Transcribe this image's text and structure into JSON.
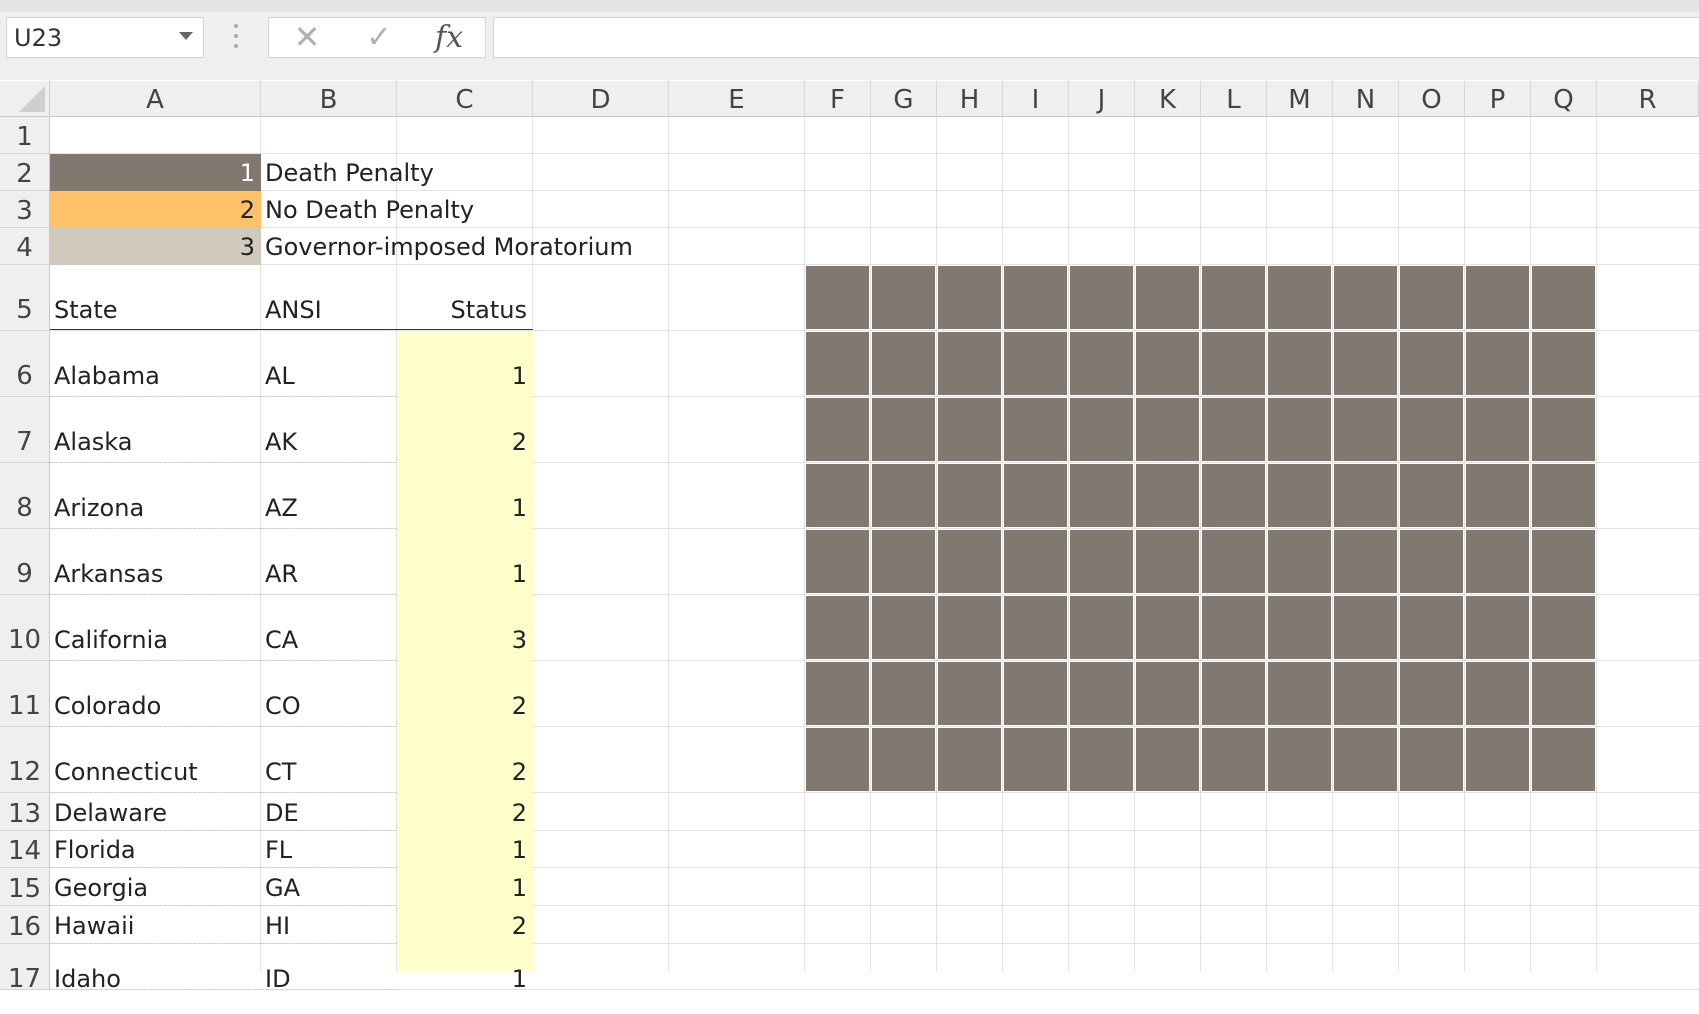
{
  "formula_bar": {
    "name_box": "U23",
    "cancel_glyph": "✕",
    "enter_glyph": "✓",
    "fx_label": "fx",
    "formula": ""
  },
  "columns": [
    "A",
    "B",
    "C",
    "D",
    "E",
    "F",
    "G",
    "H",
    "I",
    "J",
    "K",
    "L",
    "M",
    "N",
    "O",
    "P",
    "Q",
    "R"
  ],
  "rows": [
    "1",
    "2",
    "3",
    "4",
    "5",
    "6",
    "7",
    "8",
    "9",
    "10",
    "11",
    "12",
    "13",
    "14",
    "15",
    "16",
    "17"
  ],
  "legend": [
    {
      "code": "1",
      "label": "Death Penalty",
      "color": "#817870",
      "text_color": "#ffffff"
    },
    {
      "code": "2",
      "label": "No Death Penalty",
      "color": "#ffc26b",
      "text_color": "#222222"
    },
    {
      "code": "3",
      "label": "Governor-imposed Moratorium",
      "color": "#d2c9bd",
      "text_color": "#222222"
    }
  ],
  "table_headers": {
    "state": "State",
    "ansi": "ANSI",
    "status": "Status"
  },
  "states": [
    {
      "state": "Alabama",
      "ansi": "AL",
      "status": "1"
    },
    {
      "state": "Alaska",
      "ansi": "AK",
      "status": "2"
    },
    {
      "state": "Arizona",
      "ansi": "AZ",
      "status": "1"
    },
    {
      "state": "Arkansas",
      "ansi": "AR",
      "status": "1"
    },
    {
      "state": "California",
      "ansi": "CA",
      "status": "3"
    },
    {
      "state": "Colorado",
      "ansi": "CO",
      "status": "2"
    },
    {
      "state": "Connecticut",
      "ansi": "CT",
      "status": "2"
    },
    {
      "state": "Delaware",
      "ansi": "DE",
      "status": "2"
    },
    {
      "state": "Florida",
      "ansi": "FL",
      "status": "1"
    },
    {
      "state": "Georgia",
      "ansi": "GA",
      "status": "1"
    },
    {
      "state": "Hawaii",
      "ansi": "HI",
      "status": "2"
    },
    {
      "state": "Idaho",
      "ansi": "ID",
      "status": "1"
    }
  ],
  "colors": {
    "status_fill": "#ffffcc",
    "tile_fill": "#817870"
  },
  "tile_grid": {
    "columns": 12,
    "rows": 8
  }
}
